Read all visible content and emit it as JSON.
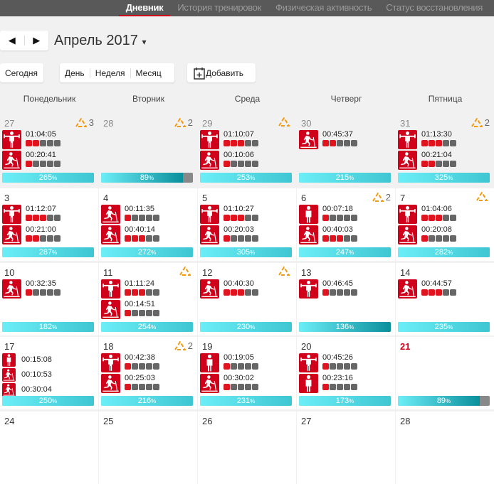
{
  "nav": {
    "tabs": [
      "Дневник",
      "История тренировок",
      "Физическая активность",
      "Статус восстановления"
    ],
    "active": 0
  },
  "calendar": {
    "month_title": "Апрель 2017",
    "prev": "◀",
    "next": "▶",
    "caret": "▾"
  },
  "toolbar": {
    "today": "Сегодня",
    "day": "День",
    "week": "Неделя",
    "month": "Месяц",
    "add": "Добавить"
  },
  "weekdays": [
    "Понедельник",
    "Вторник",
    "Среда",
    "Четверг",
    "Пятница"
  ],
  "colors": {
    "accent": "#d0021b",
    "bar": "#3ec6d2"
  },
  "weeks": [
    [
      {
        "day": "27",
        "other": true,
        "warn": "3",
        "acts": [
          {
            "icon": "strength",
            "time": "01:04:05",
            "level": 2
          },
          {
            "icon": "treadmill",
            "time": "00:20:41",
            "level": 1
          }
        ],
        "pct": 265
      },
      {
        "day": "28",
        "other": true,
        "warn": "2",
        "acts": [],
        "pct": 89
      },
      {
        "day": "29",
        "other": true,
        "warn": "",
        "acts": [
          {
            "icon": "strength",
            "time": "01:10:07",
            "level": 3
          },
          {
            "icon": "treadmill",
            "time": "00:10:06",
            "level": 1
          }
        ],
        "pct": 253
      },
      {
        "day": "30",
        "other": true,
        "acts": [
          {
            "icon": "treadmill",
            "time": "00:45:37",
            "level": 2
          }
        ],
        "pct": 215
      },
      {
        "day": "31",
        "other": true,
        "warn": "2",
        "acts": [
          {
            "icon": "strength",
            "time": "01:13:30",
            "level": 3
          },
          {
            "icon": "treadmill",
            "time": "00:21:04",
            "level": 2
          }
        ],
        "pct": 325
      }
    ],
    [
      {
        "day": "3",
        "acts": [
          {
            "icon": "strength",
            "time": "01:12:07",
            "level": 3
          },
          {
            "icon": "treadmill",
            "time": "00:21:00",
            "level": 2
          }
        ],
        "pct": 287
      },
      {
        "day": "4",
        "acts": [
          {
            "icon": "treadmill",
            "time": "00:11:35",
            "level": 1
          },
          {
            "icon": "treadmill",
            "time": "00:40:14",
            "level": 3
          }
        ],
        "pct": 272
      },
      {
        "day": "5",
        "acts": [
          {
            "icon": "strength",
            "time": "01:10:27",
            "level": 3
          },
          {
            "icon": "treadmill",
            "time": "00:20:03",
            "level": 1
          }
        ],
        "pct": 305
      },
      {
        "day": "6",
        "warn": "2",
        "acts": [
          {
            "icon": "person",
            "time": "00:07:18",
            "level": 1
          },
          {
            "icon": "treadmill",
            "time": "00:40:03",
            "level": 3
          }
        ],
        "pct": 247
      },
      {
        "day": "7",
        "warn": "",
        "acts": [
          {
            "icon": "strength",
            "time": "01:04:06",
            "level": 3
          },
          {
            "icon": "treadmill",
            "time": "00:20:08",
            "level": 1
          }
        ],
        "pct": 282
      }
    ],
    [
      {
        "day": "10",
        "acts": [
          {
            "icon": "treadmill",
            "time": "00:32:35",
            "level": 1
          }
        ],
        "pct": 182
      },
      {
        "day": "11",
        "warn": "",
        "acts": [
          {
            "icon": "strength",
            "time": "01:11:24",
            "level": 3
          },
          {
            "icon": "treadmill",
            "time": "00:14:51",
            "level": 1
          }
        ],
        "pct": 254
      },
      {
        "day": "12",
        "warn": "",
        "acts": [
          {
            "icon": "treadmill",
            "time": "00:40:30",
            "level": 3
          }
        ],
        "pct": 230
      },
      {
        "day": "13",
        "acts": [
          {
            "icon": "strength",
            "time": "00:46:45",
            "level": 1
          }
        ],
        "pct": 136
      },
      {
        "day": "14",
        "acts": [
          {
            "icon": "treadmill",
            "time": "00:44:57",
            "level": 3
          }
        ],
        "pct": 235
      }
    ],
    [
      {
        "day": "17",
        "acts": [
          {
            "icon": "person",
            "time": "00:15:08",
            "small": true
          },
          {
            "icon": "treadmill",
            "time": "00:10:53",
            "small": true
          },
          {
            "icon": "treadmill",
            "time": "00:30:04",
            "small": true
          }
        ],
        "pct": 250
      },
      {
        "day": "18",
        "warn": "2",
        "acts": [
          {
            "icon": "strength",
            "time": "00:42:38",
            "level": 1
          },
          {
            "icon": "treadmill",
            "time": "00:25:03",
            "level": 1
          }
        ],
        "pct": 216
      },
      {
        "day": "19",
        "acts": [
          {
            "icon": "person",
            "time": "00:19:05",
            "level": 1
          },
          {
            "icon": "treadmill",
            "time": "00:30:02",
            "level": 1
          }
        ],
        "pct": 231
      },
      {
        "day": "20",
        "acts": [
          {
            "icon": "strength",
            "time": "00:45:26",
            "level": 1
          },
          {
            "icon": "person",
            "time": "00:23:16",
            "level": 1
          }
        ],
        "pct": 173
      },
      {
        "day": "21",
        "today": true,
        "acts": [],
        "pct": 89
      }
    ],
    [
      {
        "day": "24",
        "acts": []
      },
      {
        "day": "25",
        "acts": []
      },
      {
        "day": "26",
        "acts": []
      },
      {
        "day": "27",
        "acts": []
      },
      {
        "day": "28",
        "acts": []
      }
    ]
  ]
}
